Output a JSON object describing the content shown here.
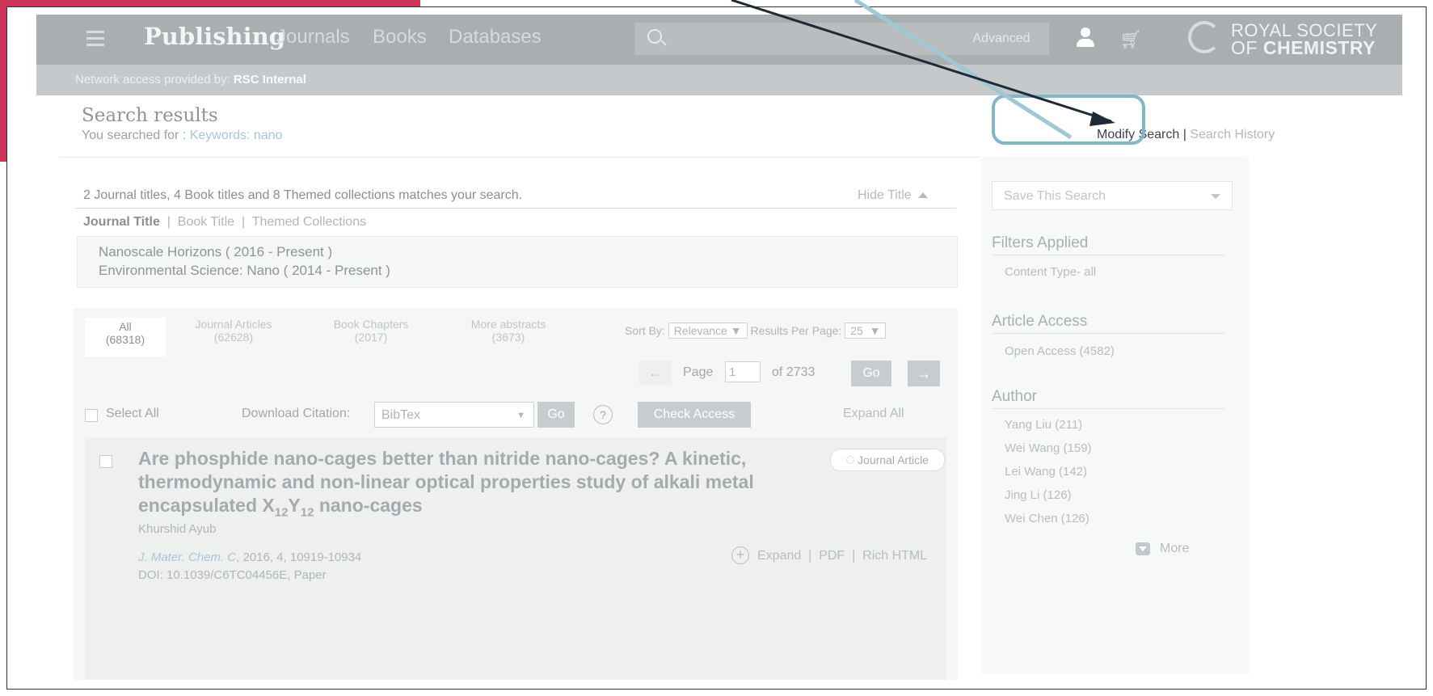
{
  "header": {
    "brand": "Publishing",
    "nav": [
      "Journals",
      "Books",
      "Databases"
    ],
    "advanced": "Advanced",
    "logo_line1": "ROYAL SOCIETY",
    "logo_of": "OF ",
    "logo_line2": "CHEMISTRY"
  },
  "access": {
    "label": "Network access provided by: ",
    "value": "RSC Internal"
  },
  "page": {
    "title": "Search results",
    "searched_label": "You searched for : ",
    "searched_value": "Keywords: nano",
    "modify": "Modify Search",
    "sep": " | ",
    "history": "Search History"
  },
  "summary": {
    "text": "2 Journal titles, 4 Book titles and 8 Themed collections matches your search.",
    "hide": "Hide Title",
    "tabs": [
      "Journal Title",
      "Book Title",
      "Themed Collections"
    ],
    "titles": [
      "Nanoscale Horizons ( 2016 - Present )",
      "Environmental Science: Nano ( 2014 - Present )"
    ]
  },
  "results": {
    "tabs": [
      {
        "label": "All",
        "count": "(68318)"
      },
      {
        "label": "Journal Articles",
        "count": "(62628)"
      },
      {
        "label": "Book Chapters",
        "count": "(2017)"
      },
      {
        "label": "More abstracts",
        "count": "(3673)"
      }
    ],
    "sort_label": "Sort By:",
    "sort_value": "Relevance",
    "per_page_label": "Results Per Page:",
    "per_page_value": "25",
    "page_label": "Page",
    "page_value": "1",
    "of_label": "of",
    "total_pages": "2733",
    "go": "Go",
    "select_all": "Select All",
    "download_label": "Download Citation:",
    "download_value": "BibTex",
    "help": "?",
    "check_access": "Check Access",
    "expand_all": "Expand All"
  },
  "article": {
    "title_line1": "Are phosphide nano-cages better than nitride nano-cages? A kinetic,",
    "title_line2": "thermodynamic and non-linear optical properties study of alkali metal",
    "title_line3a": "encapsulated X",
    "sub1": "12",
    "title_y": "Y",
    "sub2": "12",
    "title_line3b": " nano-cages",
    "badge": "Journal Article",
    "author": "Khurshid Ayub",
    "journal": "J. Mater. Chem. C",
    "citation": ", 2016, 4, 10919-10934",
    "doi": "DOI: 10.1039/C6TC04456E, Paper",
    "expand": "Expand",
    "pdf": "PDF",
    "html": "Rich HTML"
  },
  "sidebar": {
    "save": "Save This Search",
    "filters_h": "Filters Applied",
    "filters": [
      "Content Type- all"
    ],
    "access_h": "Article Access",
    "access": [
      "Open Access (4582)"
    ],
    "author_h": "Author",
    "authors": [
      "Yang Liu (211)",
      "Wei Wang (159)",
      "Lei Wang (142)",
      "Jing Li (126)",
      "Wei Chen (126)"
    ],
    "more": "More"
  }
}
